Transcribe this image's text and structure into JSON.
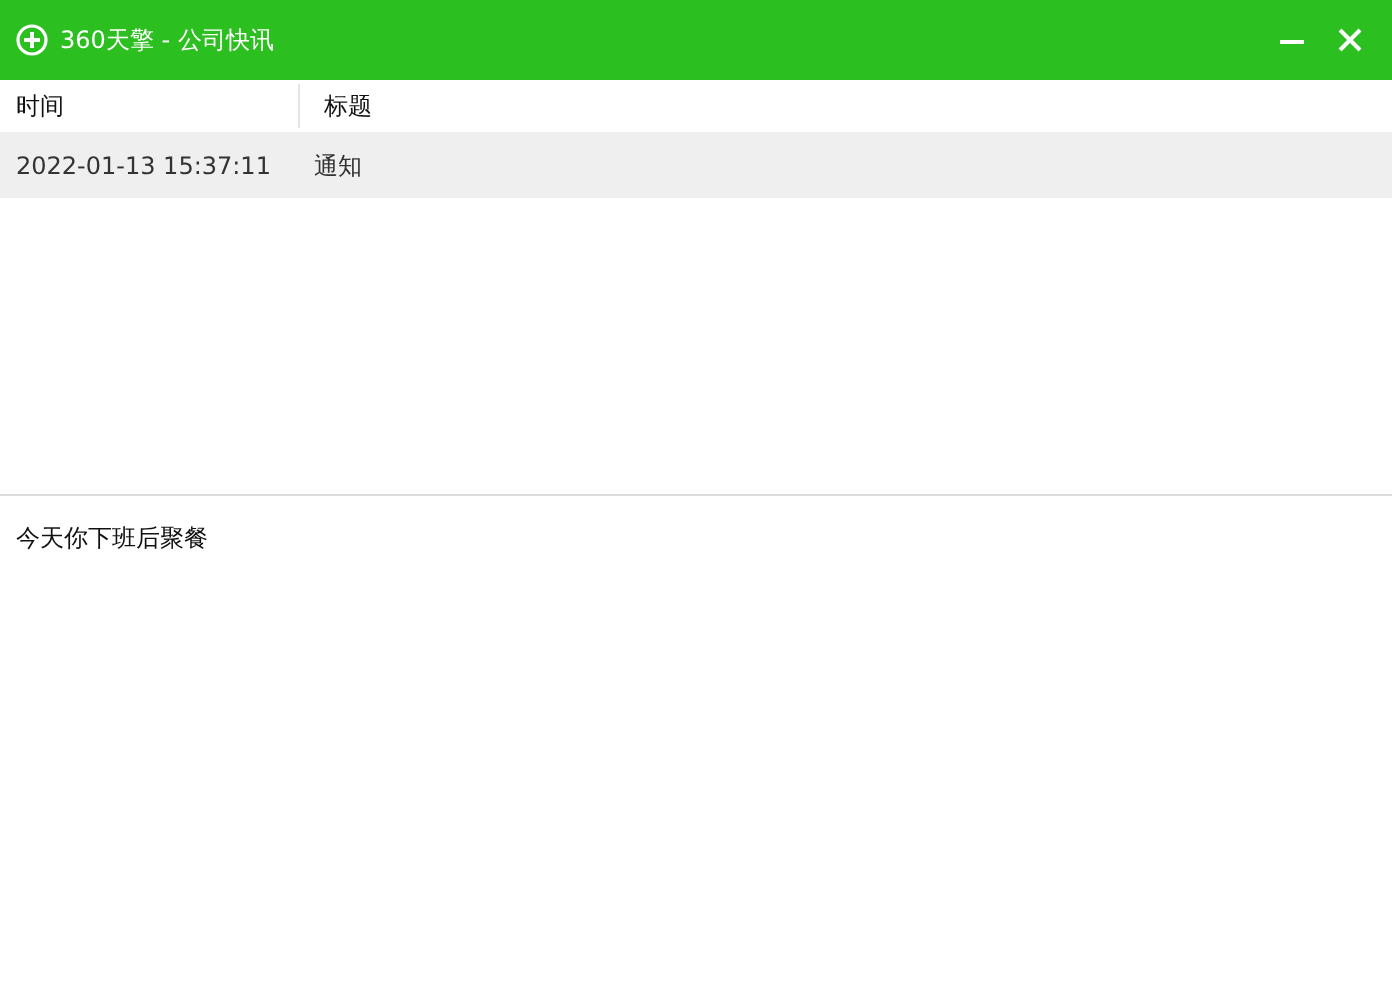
{
  "window": {
    "title": "360天擎 - 公司快讯"
  },
  "table": {
    "columns": [
      "时间",
      "标题"
    ],
    "rows": [
      {
        "time": "2022-01-13 15:37:11",
        "title": "通知",
        "selected": true
      }
    ]
  },
  "message": {
    "text": "今天你下班后聚餐"
  }
}
